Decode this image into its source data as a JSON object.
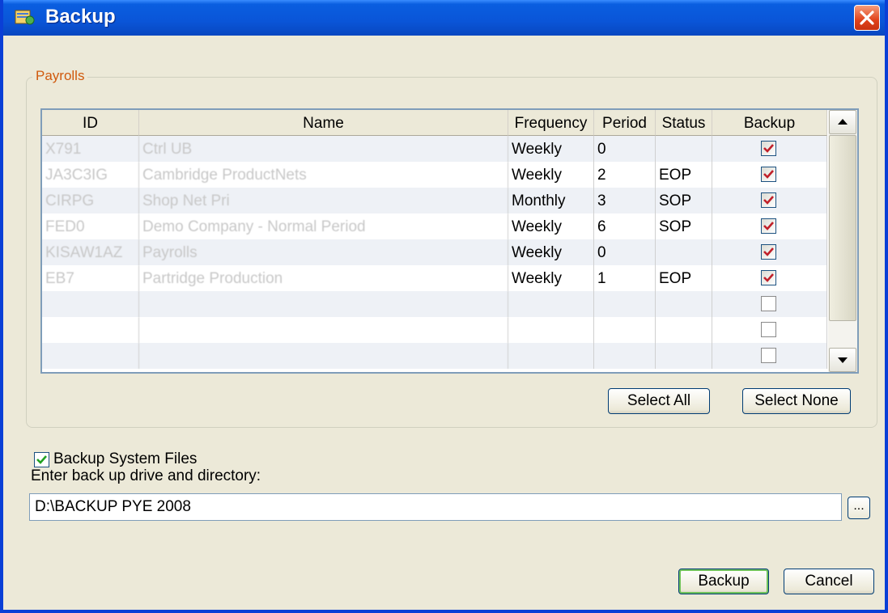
{
  "window": {
    "title": "Backup"
  },
  "group": {
    "label": "Payrolls"
  },
  "table": {
    "columns": [
      "ID",
      "Name",
      "Frequency",
      "Period",
      "Status",
      "Backup"
    ],
    "rows": [
      {
        "id": "X791",
        "name": "Ctrl UB",
        "frequency": "Weekly",
        "period": "0",
        "status": "",
        "checked": true
      },
      {
        "id": "JA3C3IG",
        "name": "Cambridge ProductNets",
        "frequency": "Weekly",
        "period": "2",
        "status": "EOP",
        "checked": true
      },
      {
        "id": "CIRPG",
        "name": "Shop Net Pri",
        "frequency": "Monthly",
        "period": "3",
        "status": "SOP",
        "checked": true
      },
      {
        "id": "FED0",
        "name": "Demo Company - Normal Period",
        "frequency": "Weekly",
        "period": "6",
        "status": "SOP",
        "checked": true
      },
      {
        "id": "KISAW1AZ",
        "name": "Payrolls",
        "frequency": "Weekly",
        "period": "0",
        "status": "",
        "checked": true
      },
      {
        "id": "EB7",
        "name": "Partridge Production",
        "frequency": "Weekly",
        "period": "1",
        "status": "EOP",
        "checked": true
      },
      {
        "id": "",
        "name": "",
        "frequency": "",
        "period": "",
        "status": "",
        "checked": false
      },
      {
        "id": "",
        "name": "",
        "frequency": "",
        "period": "",
        "status": "",
        "checked": false
      },
      {
        "id": "",
        "name": "",
        "frequency": "",
        "period": "",
        "status": "",
        "checked": false
      }
    ]
  },
  "buttons": {
    "select_all": "Select All",
    "select_none": "Select None",
    "backup": "Backup",
    "cancel": "Cancel",
    "browse": "..."
  },
  "system_files": {
    "label": "Backup System Files",
    "checked": true
  },
  "directory": {
    "label": "Enter back up drive and directory:",
    "value": "D:\\BACKUP PYE 2008"
  },
  "colors": {
    "titlebar": "#0a55d8",
    "group_label": "#d05a0e",
    "check": "#c0202a"
  }
}
